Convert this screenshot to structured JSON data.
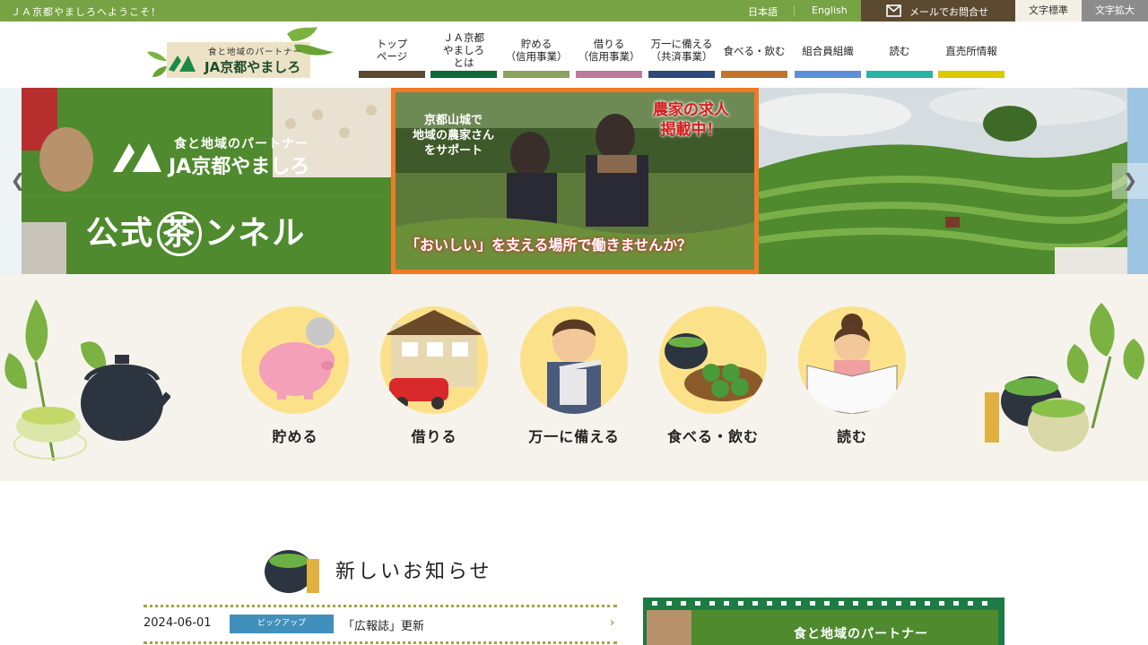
{
  "topbar": {
    "welcome": "ＪＡ京都やましろへようこそ！",
    "lang_ja": "日本語",
    "lang_en": "English",
    "mail_label": "メールでお問合せ",
    "font_normal": "文字標準",
    "font_large": "文字拡大"
  },
  "logo": {
    "tagline": "食と地域のパートナー",
    "name": "JA京都やましろ"
  },
  "nav": [
    {
      "label": "トップ\nページ",
      "color": "#5b4a30"
    },
    {
      "label": "ＪＡ京都\nやましろ\nとは",
      "color": "#0f6a3a"
    },
    {
      "label": "貯める\n（信用事業）",
      "color": "#8aa460"
    },
    {
      "label": "借りる\n（信用事業）",
      "color": "#c07a9c"
    },
    {
      "label": "万一に備える\n（共済事業）",
      "color": "#2e4a7a"
    },
    {
      "label": "食べる・飲む",
      "color": "#c0742c"
    },
    {
      "label": "組合員組織",
      "color": "#5c8fd8"
    },
    {
      "label": "読む",
      "color": "#2bb3a3"
    },
    {
      "label": "直売所情報",
      "color": "#dcc800"
    }
  ],
  "carousel": {
    "slide1": {
      "tagline": "食と地域のパートナー",
      "name": "JA京都やましろ",
      "channel": "公式茶ンネル",
      "channel_a": "公式",
      "channel_b": "茶",
      "channel_c": "ンネル"
    },
    "slide2": {
      "sub": "京都山城で\n地域の農家さん\nをサポート",
      "headline": "農家の求人\n掲載中！",
      "bottom": "「おいしい」を支える場所で働きませんか？"
    },
    "prev_icon": "chevron-left-icon",
    "next_icon": "chevron-right-icon"
  },
  "categories": [
    {
      "label": "貯める"
    },
    {
      "label": "借りる"
    },
    {
      "label": "万一に備える"
    },
    {
      "label": "食べる・飲む"
    },
    {
      "label": "読む"
    }
  ],
  "news": {
    "title": "新しいお知らせ",
    "items": [
      {
        "date": "2024-06-01",
        "badge": "ピックアップ",
        "title": "「広報誌」更新"
      }
    ]
  },
  "banner": {
    "tagline": "食と地域のパートナー"
  }
}
